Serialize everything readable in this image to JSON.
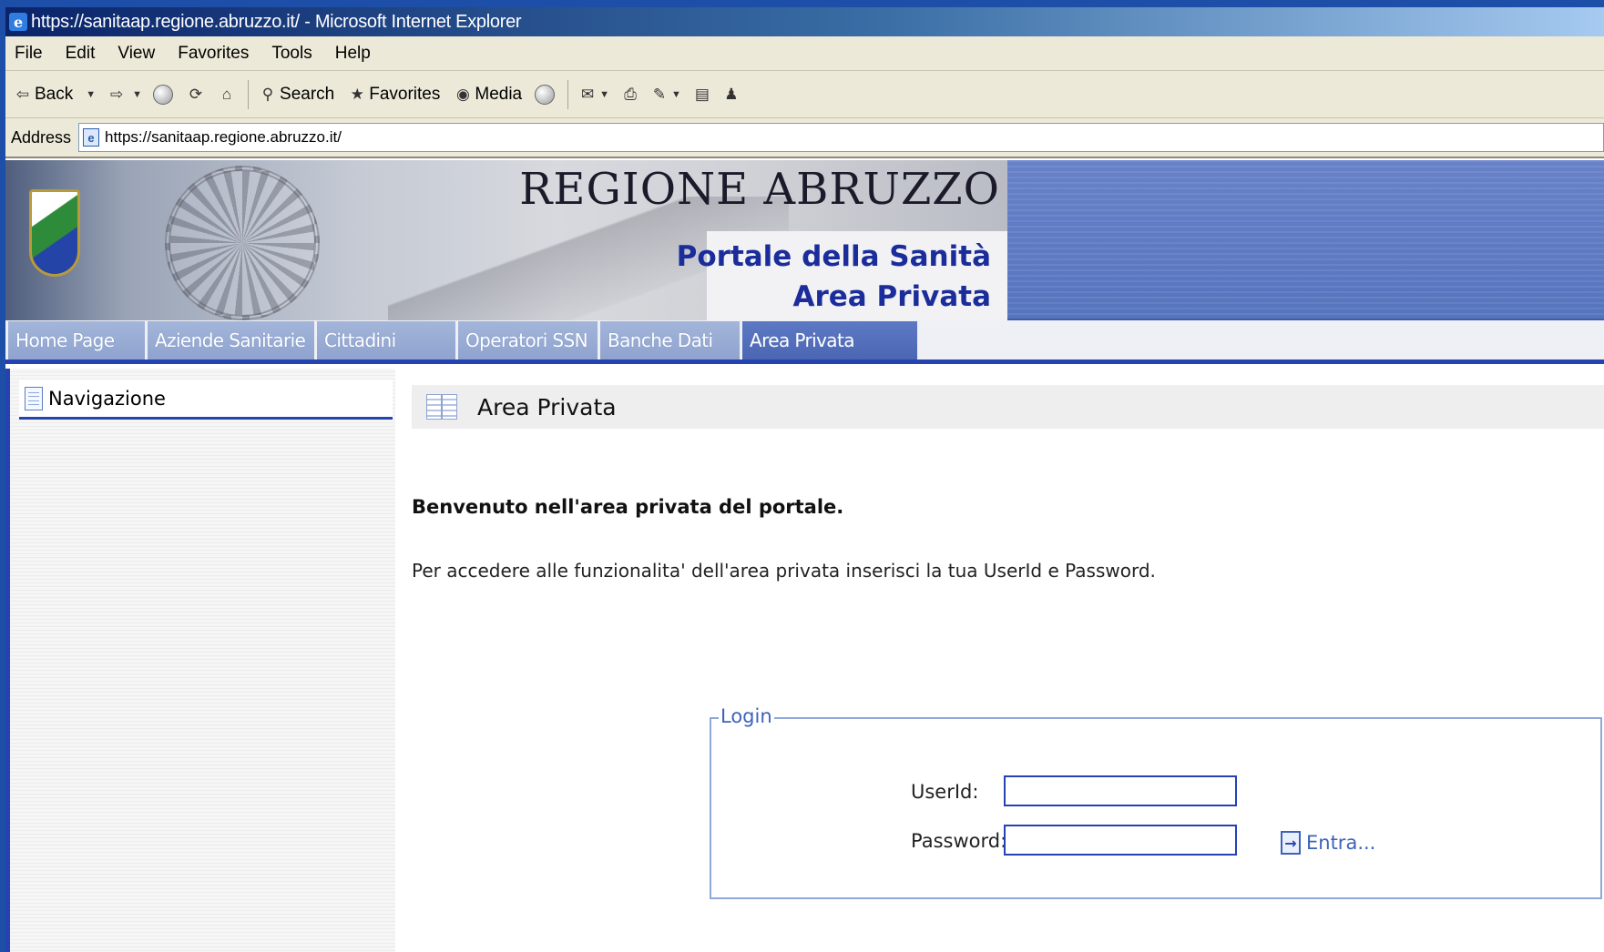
{
  "window": {
    "title": "https://sanitaap.regione.abruzzo.it/ - Microsoft Internet Explorer"
  },
  "menu": [
    "File",
    "Edit",
    "View",
    "Favorites",
    "Tools",
    "Help"
  ],
  "toolbar": {
    "back_label": "Back",
    "search_label": "Search",
    "favorites_label": "Favorites",
    "media_label": "Media"
  },
  "address": {
    "label": "Address",
    "url": "https://sanitaap.regione.abruzzo.it/"
  },
  "banner": {
    "title": "REGIONE ABRUZZO",
    "subtitle_1": "Portale della Sanità",
    "subtitle_2": "Area Privata"
  },
  "nav_tabs": [
    {
      "label": "Home Page"
    },
    {
      "label": "Aziende Sanitarie"
    },
    {
      "label": "Cittadini"
    },
    {
      "label": "Operatori SSN"
    },
    {
      "label": "Banche Dati"
    },
    {
      "label": "Area Privata"
    }
  ],
  "sidebar": {
    "header": "Navigazione"
  },
  "main": {
    "section_title": "Area Privata",
    "welcome": "Benvenuto nell'area privata del portale.",
    "instruction": "Per accedere alle funzionalita' dell'area privata inserisci la tua UserId e Password."
  },
  "login": {
    "legend": "Login",
    "userid_label": "UserId:",
    "userid_value": "",
    "password_label": "Password:",
    "password_value": "",
    "submit_label": "Entra..."
  },
  "colors": {
    "accent": "#2443b0",
    "link": "#3d63b8",
    "tab_active": "#4b66b3",
    "tab_inactive": "#8ea3cf"
  }
}
